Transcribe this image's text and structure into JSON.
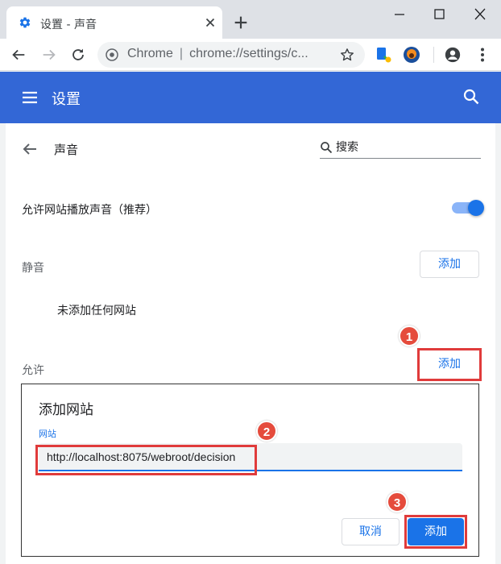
{
  "browser": {
    "tab": {
      "title": "设置 - 声音",
      "favicon": "gear-icon"
    },
    "omnibox": {
      "site_name": "Chrome",
      "separator": "|",
      "url": "chrome://settings/c..."
    }
  },
  "settings": {
    "header_title": "设置",
    "page_title": "声音",
    "search_placeholder": "搜索",
    "allow_sound": {
      "label": "允许网站播放声音（推荐）",
      "enabled": true
    },
    "mute": {
      "label": "静音",
      "add_button": "添加",
      "empty_text": "未添加任何网站"
    },
    "allow": {
      "label": "允许",
      "add_button": "添加"
    }
  },
  "dialog": {
    "title": "添加网站",
    "field_label": "网站",
    "field_value": "http://localhost:8075/webroot/decision",
    "cancel_button": "取消",
    "add_button": "添加"
  },
  "annotations": {
    "step1": "1",
    "step2": "2",
    "step3": "3",
    "color": "#e03b3b"
  },
  "colors": {
    "header": "#3367d6",
    "accent": "#1a73e8"
  }
}
